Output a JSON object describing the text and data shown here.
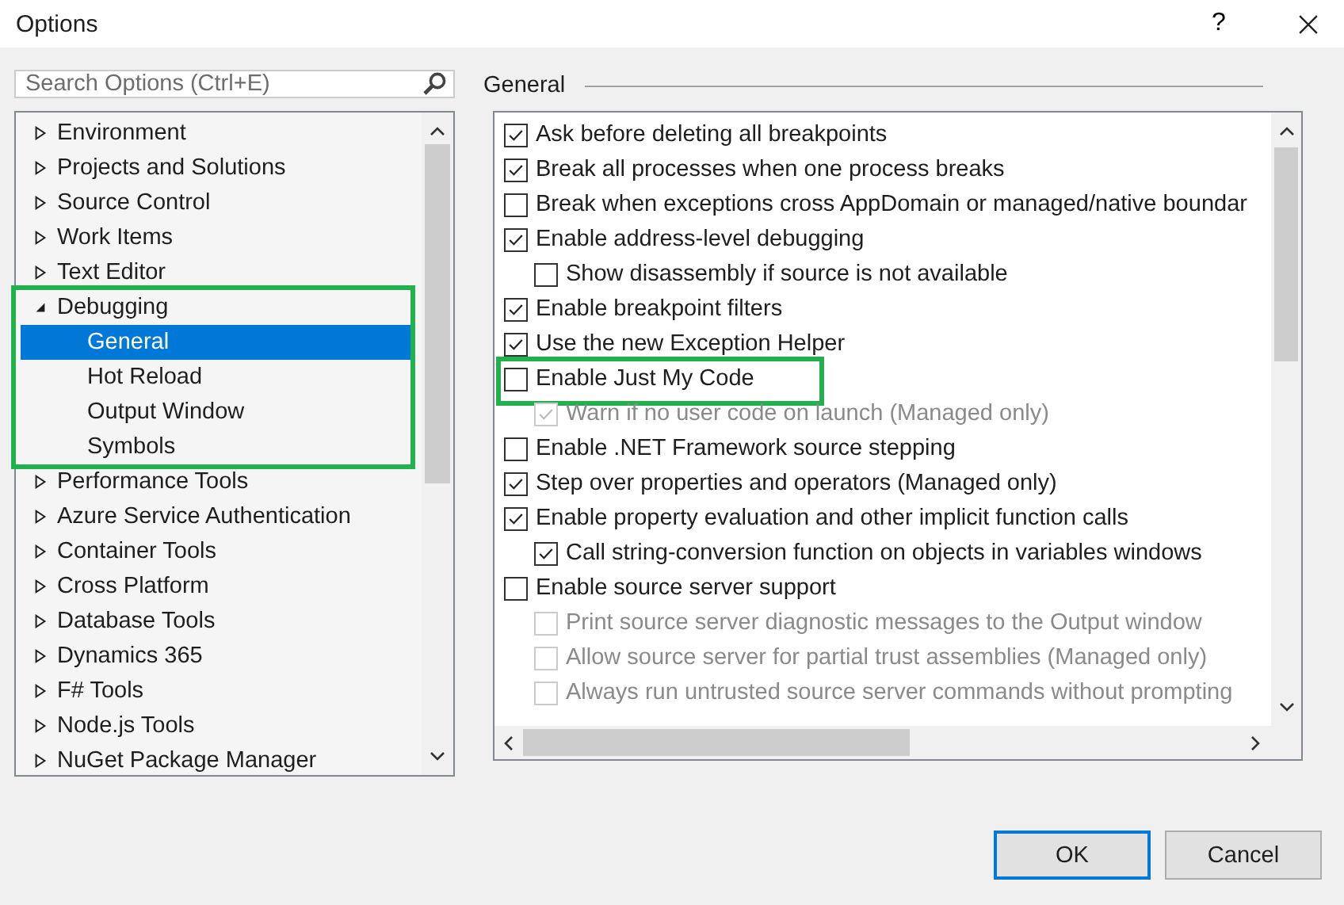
{
  "window": {
    "title": "Options",
    "help": "?"
  },
  "search": {
    "placeholder": "Search Options (Ctrl+E)"
  },
  "tree": [
    {
      "label": "Environment",
      "expanded": false,
      "selected": false,
      "highlighted": false
    },
    {
      "label": "Projects and Solutions",
      "expanded": false,
      "selected": false,
      "highlighted": false
    },
    {
      "label": "Source Control",
      "expanded": false,
      "selected": false,
      "highlighted": false
    },
    {
      "label": "Work Items",
      "expanded": false,
      "selected": false,
      "highlighted": false
    },
    {
      "label": "Text Editor",
      "expanded": false,
      "selected": false,
      "highlighted": false
    },
    {
      "label": "Debugging",
      "expanded": true,
      "selected": false,
      "highlighted": true,
      "children": [
        {
          "label": "General",
          "selected": true
        },
        {
          "label": "Hot Reload",
          "selected": false
        },
        {
          "label": "Output Window",
          "selected": false
        },
        {
          "label": "Symbols",
          "selected": false
        }
      ]
    },
    {
      "label": "Performance Tools",
      "expanded": false,
      "selected": false,
      "highlighted": false
    },
    {
      "label": "Azure Service Authentication",
      "expanded": false,
      "selected": false,
      "highlighted": false
    },
    {
      "label": "Container Tools",
      "expanded": false,
      "selected": false,
      "highlighted": false
    },
    {
      "label": "Cross Platform",
      "expanded": false,
      "selected": false,
      "highlighted": false
    },
    {
      "label": "Database Tools",
      "expanded": false,
      "selected": false,
      "highlighted": false
    },
    {
      "label": "Dynamics 365",
      "expanded": false,
      "selected": false,
      "highlighted": false
    },
    {
      "label": "F# Tools",
      "expanded": false,
      "selected": false,
      "highlighted": false
    },
    {
      "label": "Node.js Tools",
      "expanded": false,
      "selected": false,
      "highlighted": false
    },
    {
      "label": "NuGet Package Manager",
      "expanded": false,
      "selected": false,
      "highlighted": false
    }
  ],
  "section_title": "General",
  "options": [
    {
      "label": "Ask before deleting all breakpoints",
      "checked": true,
      "disabled": false,
      "highlighted": false
    },
    {
      "label": "Break all processes when one process breaks",
      "checked": true,
      "disabled": false,
      "highlighted": false
    },
    {
      "label": "Break when exceptions cross AppDomain or managed/native boundar",
      "checked": false,
      "disabled": false,
      "highlighted": false
    },
    {
      "label": "Enable address-level debugging",
      "checked": true,
      "disabled": false,
      "highlighted": false,
      "children": [
        {
          "label": "Show disassembly if source is not available",
          "checked": false,
          "disabled": false
        }
      ]
    },
    {
      "label": "Enable breakpoint filters",
      "checked": true,
      "disabled": false,
      "highlighted": false
    },
    {
      "label": "Use the new Exception Helper",
      "checked": true,
      "disabled": false,
      "highlighted": false
    },
    {
      "label": "Enable Just My Code",
      "checked": false,
      "disabled": false,
      "highlighted": true,
      "children": [
        {
          "label": "Warn if no user code on launch (Managed only)",
          "checked": true,
          "disabled": true
        }
      ]
    },
    {
      "label": "Enable .NET Framework source stepping",
      "checked": false,
      "disabled": false,
      "highlighted": false
    },
    {
      "label": "Step over properties and operators (Managed only)",
      "checked": true,
      "disabled": false,
      "highlighted": false
    },
    {
      "label": "Enable property evaluation and other implicit function calls",
      "checked": true,
      "disabled": false,
      "highlighted": false,
      "children": [
        {
          "label": "Call string-conversion function on objects in variables windows",
          "checked": true,
          "disabled": false
        }
      ]
    },
    {
      "label": "Enable source server support",
      "checked": false,
      "disabled": false,
      "highlighted": false,
      "children": [
        {
          "label": "Print source server diagnostic messages to the Output window",
          "checked": false,
          "disabled": true
        },
        {
          "label": "Allow source server for partial trust assemblies (Managed only)",
          "checked": false,
          "disabled": true
        },
        {
          "label": "Always run untrusted source server commands without prompting",
          "checked": false,
          "disabled": true
        }
      ]
    }
  ],
  "buttons": [
    {
      "label": "OK",
      "default": true
    },
    {
      "label": "Cancel",
      "default": false
    }
  ]
}
